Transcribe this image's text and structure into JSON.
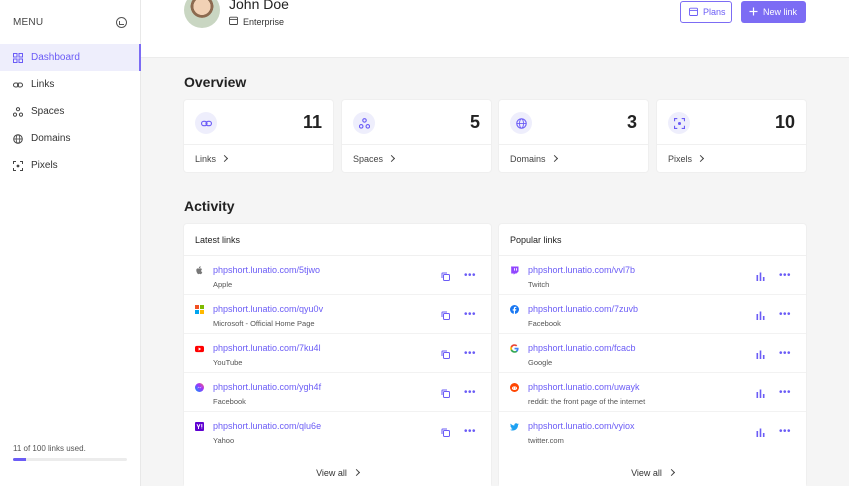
{
  "sidebar": {
    "menu_label": "MENU",
    "items": [
      {
        "label": "Dashboard",
        "icon": "grid-icon",
        "active": true
      },
      {
        "label": "Links",
        "icon": "link-icon",
        "active": false
      },
      {
        "label": "Spaces",
        "icon": "spaces-icon",
        "active": false
      },
      {
        "label": "Domains",
        "icon": "globe-icon",
        "active": false
      },
      {
        "label": "Pixels",
        "icon": "pixel-icon",
        "active": false
      }
    ],
    "usage_text": "11 of 100 links used.",
    "usage_fraction": 0.11
  },
  "header": {
    "user_name": "John Doe",
    "plan": "Enterprise",
    "plans_button": "Plans",
    "new_link_button": "New link"
  },
  "overview": {
    "title": "Overview",
    "cards": [
      {
        "label": "Links",
        "count": "11",
        "icon": "link-icon"
      },
      {
        "label": "Spaces",
        "count": "5",
        "icon": "spaces-icon"
      },
      {
        "label": "Domains",
        "count": "3",
        "icon": "globe-icon"
      },
      {
        "label": "Pixels",
        "count": "10",
        "icon": "pixel-icon"
      }
    ]
  },
  "activity": {
    "title": "Activity",
    "latest": {
      "title": "Latest links",
      "rows": [
        {
          "url": "phpshort.lunatio.com/5tjwo",
          "title": "Apple",
          "favicon": "apple-icon"
        },
        {
          "url": "phpshort.lunatio.com/qyu0v",
          "title": "Microsoft - Official Home Page",
          "favicon": "microsoft-icon"
        },
        {
          "url": "phpshort.lunatio.com/7ku4l",
          "title": "YouTube",
          "favicon": "youtube-icon"
        },
        {
          "url": "phpshort.lunatio.com/ygh4f",
          "title": "Facebook",
          "favicon": "messenger-icon"
        },
        {
          "url": "phpshort.lunatio.com/qlu6e",
          "title": "Yahoo",
          "favicon": "yahoo-icon"
        }
      ],
      "view_all": "View all"
    },
    "popular": {
      "title": "Popular links",
      "rows": [
        {
          "url": "phpshort.lunatio.com/vvl7b",
          "title": "Twitch",
          "favicon": "twitch-icon"
        },
        {
          "url": "phpshort.lunatio.com/7zuvb",
          "title": "Facebook",
          "favicon": "facebook-icon"
        },
        {
          "url": "phpshort.lunatio.com/fcacb",
          "title": "Google",
          "favicon": "google-icon"
        },
        {
          "url": "phpshort.lunatio.com/uwayk",
          "title": "reddit: the front page of the internet",
          "favicon": "reddit-icon"
        },
        {
          "url": "phpshort.lunatio.com/vyiox",
          "title": "twitter.com",
          "favicon": "twitter-icon"
        }
      ],
      "view_all": "View all"
    }
  },
  "colors": {
    "accent": "#7c6cf4",
    "accent_text": "#6b5cf6",
    "accent_soft": "#eeeefc"
  }
}
